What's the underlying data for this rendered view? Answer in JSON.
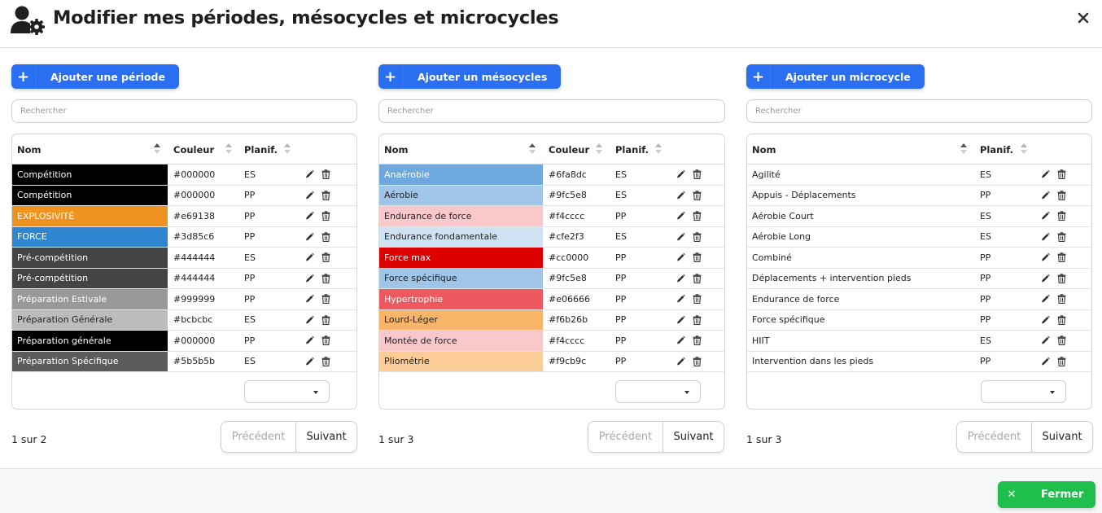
{
  "header": {
    "title": "Modifier mes périodes, mésocycles et microcycles",
    "icon": "user-gear-icon",
    "close_icon": "close-icon"
  },
  "colors": {
    "primary": "#2a6ff2",
    "success": "#1fbf4c"
  },
  "periodes": {
    "add_label": "Ajouter une période",
    "search_placeholder": "Rechercher",
    "columns": [
      "Nom",
      "Couleur",
      "Planif."
    ],
    "rows": [
      {
        "name": "Compétition",
        "color": "#000000",
        "planif": "ES",
        "bg": "#000000",
        "fg": "#ffffff"
      },
      {
        "name": "Compétition",
        "color": "#000000",
        "planif": "PP",
        "bg": "#000000",
        "fg": "#ffffff"
      },
      {
        "name": "EXPLOSIVITÉ",
        "color": "#e69138",
        "planif": "PP",
        "bg": "#f0921f",
        "fg": "#ffffff"
      },
      {
        "name": "FORCE",
        "color": "#3d85c6",
        "planif": "PP",
        "bg": "#2f85cf",
        "fg": "#ffffff"
      },
      {
        "name": "Pré-compétition",
        "color": "#444444",
        "planif": "ES",
        "bg": "#444444",
        "fg": "#ffffff"
      },
      {
        "name": "Pré-compétition",
        "color": "#444444",
        "planif": "PP",
        "bg": "#444444",
        "fg": "#ffffff"
      },
      {
        "name": "Préparation Estivale",
        "color": "#999999",
        "planif": "PP",
        "bg": "#999999",
        "fg": "#ffffff"
      },
      {
        "name": "Préparation Générale",
        "color": "#bcbcbc",
        "planif": "ES",
        "bg": "#bcbcbc",
        "fg": "#222222"
      },
      {
        "name": "Préparation générale",
        "color": "#000000",
        "planif": "PP",
        "bg": "#000000",
        "fg": "#ffffff"
      },
      {
        "name": "Préparation Spécifique",
        "color": "#5b5b5b",
        "planif": "ES",
        "bg": "#5b5b5b",
        "fg": "#ffffff"
      }
    ],
    "page_info": "1 sur 2",
    "prev_label": "Précédent",
    "next_label": "Suivant"
  },
  "mesocycles": {
    "add_label": "Ajouter un mésocycles",
    "search_placeholder": "Rechercher",
    "columns": [
      "Nom",
      "Couleur",
      "Planif."
    ],
    "rows": [
      {
        "name": "Anaérobie",
        "color": "#6fa8dc",
        "planif": "ES",
        "bg": "#6fa8dc",
        "fg": "#ffffff"
      },
      {
        "name": "Aérobie",
        "color": "#9fc5e8",
        "planif": "ES",
        "bg": "#9fc5e8",
        "fg": "#222222"
      },
      {
        "name": "Endurance de force",
        "color": "#f4cccc",
        "planif": "PP",
        "bg": "#f8c8cb",
        "fg": "#222222"
      },
      {
        "name": "Endurance fondamentale",
        "color": "#cfe2f3",
        "planif": "ES",
        "bg": "#cfe2f3",
        "fg": "#222222"
      },
      {
        "name": "Force max",
        "color": "#cc0000",
        "planif": "PP",
        "bg": "#dc0000",
        "fg": "#ffffff"
      },
      {
        "name": "Force spécifique",
        "color": "#9fc5e8",
        "planif": "PP",
        "bg": "#9fc5e8",
        "fg": "#222222"
      },
      {
        "name": "Hypertrophie",
        "color": "#e06666",
        "planif": "PP",
        "bg": "#ec5a5f",
        "fg": "#ffffff"
      },
      {
        "name": "Lourd-Léger",
        "color": "#f6b26b",
        "planif": "PP",
        "bg": "#f8b468",
        "fg": "#222222"
      },
      {
        "name": "Montée de force",
        "color": "#f4cccc",
        "planif": "PP",
        "bg": "#f8c8cb",
        "fg": "#222222"
      },
      {
        "name": "Pliométrie",
        "color": "#f9cb9c",
        "planif": "PP",
        "bg": "#fbcb98",
        "fg": "#222222"
      }
    ],
    "page_info": "1 sur 3",
    "prev_label": "Précédent",
    "next_label": "Suivant"
  },
  "microcycles": {
    "add_label": "Ajouter un microcycle",
    "search_placeholder": "Rechercher",
    "columns": [
      "Nom",
      "Planif."
    ],
    "rows": [
      {
        "name": "Agilité",
        "planif": "ES"
      },
      {
        "name": "Appuis - Déplacements",
        "planif": "PP"
      },
      {
        "name": "Aérobie Court",
        "planif": "ES"
      },
      {
        "name": "Aérobie Long",
        "planif": "ES"
      },
      {
        "name": "Combiné",
        "planif": "PP"
      },
      {
        "name": "Déplacements + intervention pieds",
        "planif": "PP"
      },
      {
        "name": "Endurance de force",
        "planif": "PP"
      },
      {
        "name": "Force spécifique",
        "planif": "PP"
      },
      {
        "name": "HIIT",
        "planif": "ES"
      },
      {
        "name": "Intervention dans les pieds",
        "planif": "PP"
      }
    ],
    "page_info": "1 sur 3",
    "prev_label": "Précédent",
    "next_label": "Suivant"
  },
  "footer": {
    "close_label": "Fermer"
  }
}
